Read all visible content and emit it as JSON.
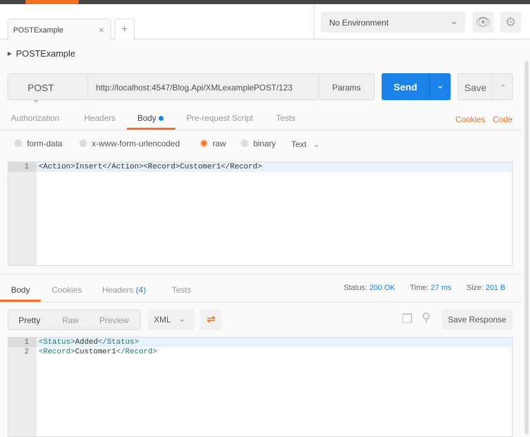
{
  "colors": {
    "accent": "#f47023",
    "primary": "#1a82e8"
  },
  "tabs": [
    {
      "label": "POSTExample",
      "close_icon": "close-icon"
    }
  ],
  "new_tab": "+",
  "environment": {
    "selected": "No Environment"
  },
  "request": {
    "name": "POSTExample",
    "method": "POST",
    "url": "http://localhost:4547/Blog.Api/XMLexamplePOST/123",
    "params_label": "Params",
    "send_label": "Send",
    "save_label": "Save"
  },
  "request_tabs": [
    {
      "label": "Authorization"
    },
    {
      "label": "Headers"
    },
    {
      "label": "Body",
      "active": true
    },
    {
      "label": "Pre-request Script"
    },
    {
      "label": "Tests"
    }
  ],
  "links": {
    "cookies": "Cookies",
    "code": "Code"
  },
  "body_modes": [
    {
      "label": "form-data"
    },
    {
      "label": "x-www-form-urlencoded"
    },
    {
      "label": "raw",
      "selected": true
    },
    {
      "label": "binary"
    }
  ],
  "raw_type": "Text",
  "request_body": [
    {
      "n": "1",
      "code": "<Action>Insert</Action><Record>Customer1</Record>"
    }
  ],
  "response": {
    "tabs": [
      {
        "label": "Body",
        "active": true
      },
      {
        "label": "Cookies"
      },
      {
        "label": "Headers",
        "count": "(4)"
      },
      {
        "label": "Tests"
      }
    ],
    "status_label": "Status:",
    "status": "200 OK",
    "time_label": "Time:",
    "time": "27 ms",
    "size_label": "Size:",
    "size": "201 B",
    "views": [
      "Pretty",
      "Raw",
      "Preview"
    ],
    "active_view": "Pretty",
    "format": "XML",
    "save_response": "Save Response",
    "lines": [
      {
        "n": "1",
        "open": "<Status>",
        "text": "Added",
        "close": "</Status>"
      },
      {
        "n": "2",
        "open": "<Record>",
        "text": "Customer1",
        "close": "</Record>"
      }
    ]
  }
}
